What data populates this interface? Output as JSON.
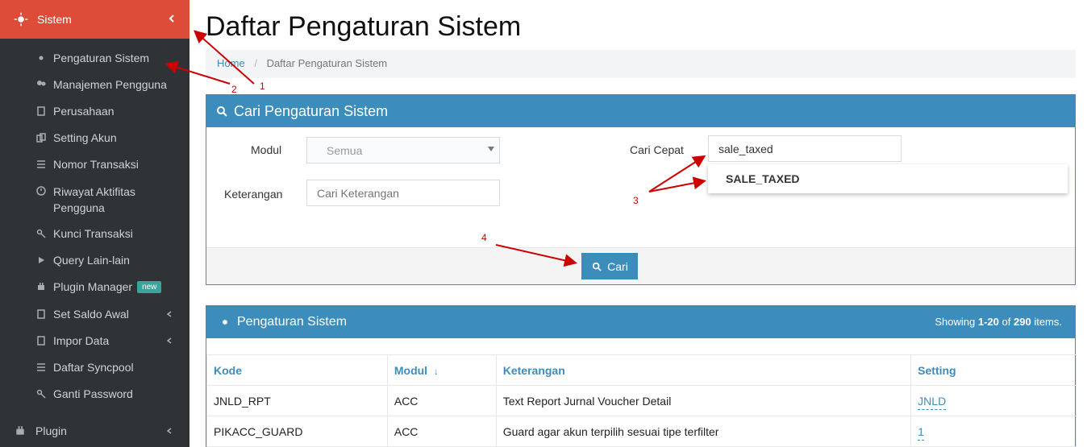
{
  "sidebar": {
    "topbar_label": "Sistem",
    "items": [
      {
        "label": "Pengaturan Sistem",
        "icon": "gear-icon"
      },
      {
        "label": "Manajemen Pengguna",
        "icon": "users-icon"
      },
      {
        "label": "Perusahaan",
        "icon": "building-icon"
      },
      {
        "label": "Setting Akun",
        "icon": "copy-icon"
      },
      {
        "label": "Nomor Transaksi",
        "icon": "list-icon"
      },
      {
        "label": "Riwayat Aktifitas Pengguna",
        "icon": "history-icon"
      },
      {
        "label": "Kunci Transaksi",
        "icon": "key-icon"
      },
      {
        "label": "Query Lain-lain",
        "icon": "play-icon"
      },
      {
        "label": "Plugin Manager",
        "icon": "plug-icon",
        "badge": "new"
      },
      {
        "label": "Set Saldo Awal",
        "icon": "calculator-icon"
      },
      {
        "label": "Impor Data",
        "icon": "calculator-icon"
      },
      {
        "label": "Daftar Syncpool",
        "icon": "list-icon"
      },
      {
        "label": "Ganti Password",
        "icon": "key-icon"
      }
    ],
    "bottom_label": "Plugin"
  },
  "main": {
    "title": "Daftar Pengaturan Sistem",
    "breadcrumb": {
      "home": "Home",
      "current": "Daftar Pengaturan Sistem"
    }
  },
  "search": {
    "title": "Cari Pengaturan Sistem",
    "modul_label": "Modul",
    "modul_selected": "Semua",
    "keterangan_label": "Keterangan",
    "keterangan_placeholder": "Cari Keterangan",
    "cari_cepat_label": "Cari Cepat",
    "cari_cepat_value": "sale_taxed",
    "suggestion": "SALE_TAXED",
    "button": "Cari"
  },
  "results": {
    "title": "Pengaturan Sistem",
    "summary_prefix": "Showing",
    "summary_range": "1-20",
    "summary_mid": "of",
    "summary_total": "290",
    "summary_suffix": "items.",
    "columns": [
      "Kode",
      "Modul",
      "Keterangan",
      "Setting"
    ],
    "rows": [
      {
        "kode": "JNLD_RPT",
        "modul": "ACC",
        "keterangan": "Text Report Jurnal Voucher Detail",
        "setting": "JNLD"
      },
      {
        "kode": "PIKACC_GUARD",
        "modul": "ACC",
        "keterangan": "Guard agar akun terpilih sesuai tipe terfilter",
        "setting": "1"
      }
    ]
  },
  "annotations": {
    "n1": "1",
    "n2": "2",
    "n3": "3",
    "n4": "4"
  },
  "colors": {
    "sidebar_bg": "#2f3336",
    "top_red": "#dd4b39",
    "accent_blue": "#3c8dbc",
    "badge_teal": "#38a49a"
  }
}
